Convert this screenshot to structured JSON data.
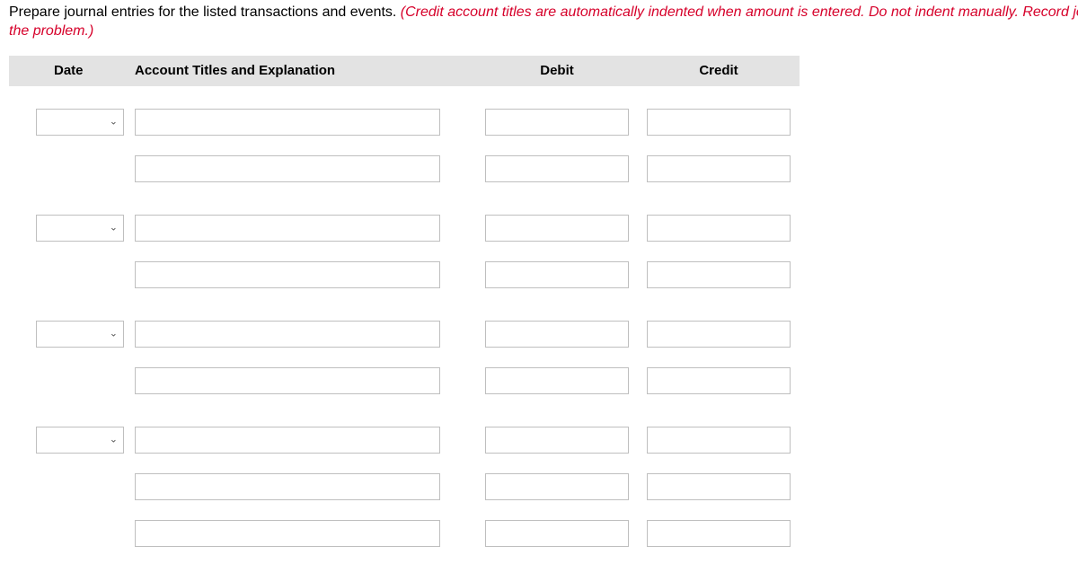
{
  "instructions": {
    "part1_black": "Prepare journal entries for the listed transactions and events. ",
    "part2_red": "(Credit account titles are automatically indented when amount is entered. Do not indent manually. Record journal entries in the order pr",
    "part3_red_line2": "the problem.)"
  },
  "headers": {
    "date": "Date",
    "titles": "Account Titles and Explanation",
    "debit": "Debit",
    "credit": "Credit"
  },
  "rows": [
    {
      "has_date": true,
      "date": "",
      "title": "",
      "debit": "",
      "credit": ""
    },
    {
      "has_date": false,
      "date": "",
      "title": "",
      "debit": "",
      "credit": ""
    },
    {
      "has_date": true,
      "date": "",
      "title": "",
      "debit": "",
      "credit": ""
    },
    {
      "has_date": false,
      "date": "",
      "title": "",
      "debit": "",
      "credit": ""
    },
    {
      "has_date": true,
      "date": "",
      "title": "",
      "debit": "",
      "credit": ""
    },
    {
      "has_date": false,
      "date": "",
      "title": "",
      "debit": "",
      "credit": ""
    },
    {
      "has_date": true,
      "date": "",
      "title": "",
      "debit": "",
      "credit": ""
    },
    {
      "has_date": false,
      "date": "",
      "title": "",
      "debit": "",
      "credit": ""
    },
    {
      "has_date": false,
      "date": "",
      "title": "",
      "debit": "",
      "credit": ""
    }
  ]
}
